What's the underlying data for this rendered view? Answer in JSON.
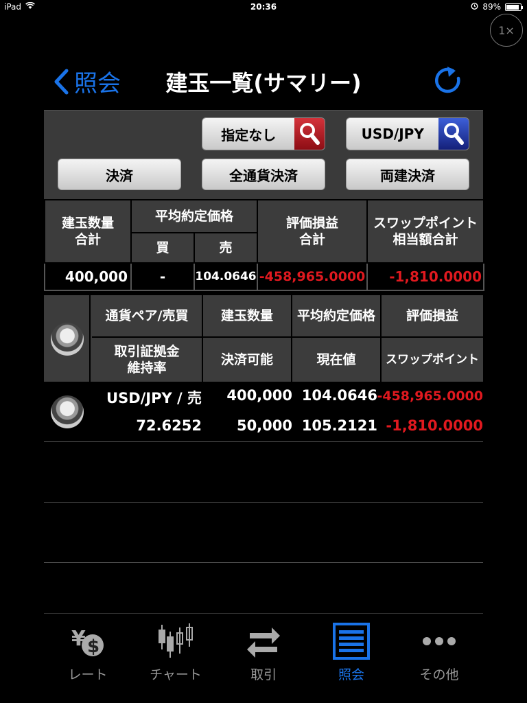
{
  "status_bar": {
    "device": "iPad",
    "time": "20:36",
    "battery": "89%",
    "battery_level": 0.89
  },
  "zoom_badge": "1×",
  "nav": {
    "back_label": "照会",
    "title": "建玉一覧(サマリー)"
  },
  "filters": {
    "filter1_label": "指定なし",
    "filter2_label": "USD/JPY",
    "settle_label": "決済",
    "settle_all_label": "全通貨決済",
    "settle_both_label": "両建決済"
  },
  "summary": {
    "headers": {
      "qty_total": [
        "建玉数量",
        "合計"
      ],
      "avg_price": "平均約定価格",
      "buy": "買",
      "sell": "売",
      "pnl_total": [
        "評価損益",
        "合計"
      ],
      "swap_total": [
        "スワップポイント",
        "相当額合計"
      ]
    },
    "values": {
      "qty_total": "400,000",
      "buy": "-",
      "sell": "104.0646",
      "pnl_total": "-458,965.0000",
      "swap_total": "-1,810.0000"
    }
  },
  "positions": {
    "headers": {
      "pair_side": "通貨ペア/売買",
      "qty": "建玉数量",
      "avg_price": "平均約定価格",
      "pnl": "評価損益",
      "margin_ratio": [
        "取引証拠金",
        "維持率"
      ],
      "settleable": "決済可能",
      "current": "現在値",
      "swap": "スワップポイント"
    },
    "rows": [
      {
        "pair_side": "USD/JPY / 売",
        "qty": "400,000",
        "avg_price": "104.0646",
        "pnl": "-458,965.0000",
        "margin_ratio": "72.6252",
        "settleable": "50,000",
        "current": "105.2121",
        "swap": "-1,810.0000"
      }
    ]
  },
  "tabs": [
    {
      "label": "レート",
      "icon": "yen-dollar-icon"
    },
    {
      "label": "チャート",
      "icon": "candlestick-icon"
    },
    {
      "label": "取引",
      "icon": "exchange-arrows-icon"
    },
    {
      "label": "照会",
      "icon": "list-icon",
      "active": true
    },
    {
      "label": "その他",
      "icon": "more-dots-icon"
    }
  ],
  "colors": {
    "accent": "#1a73e8",
    "negative": "#e0191f",
    "panel": "#3a3a3a"
  }
}
